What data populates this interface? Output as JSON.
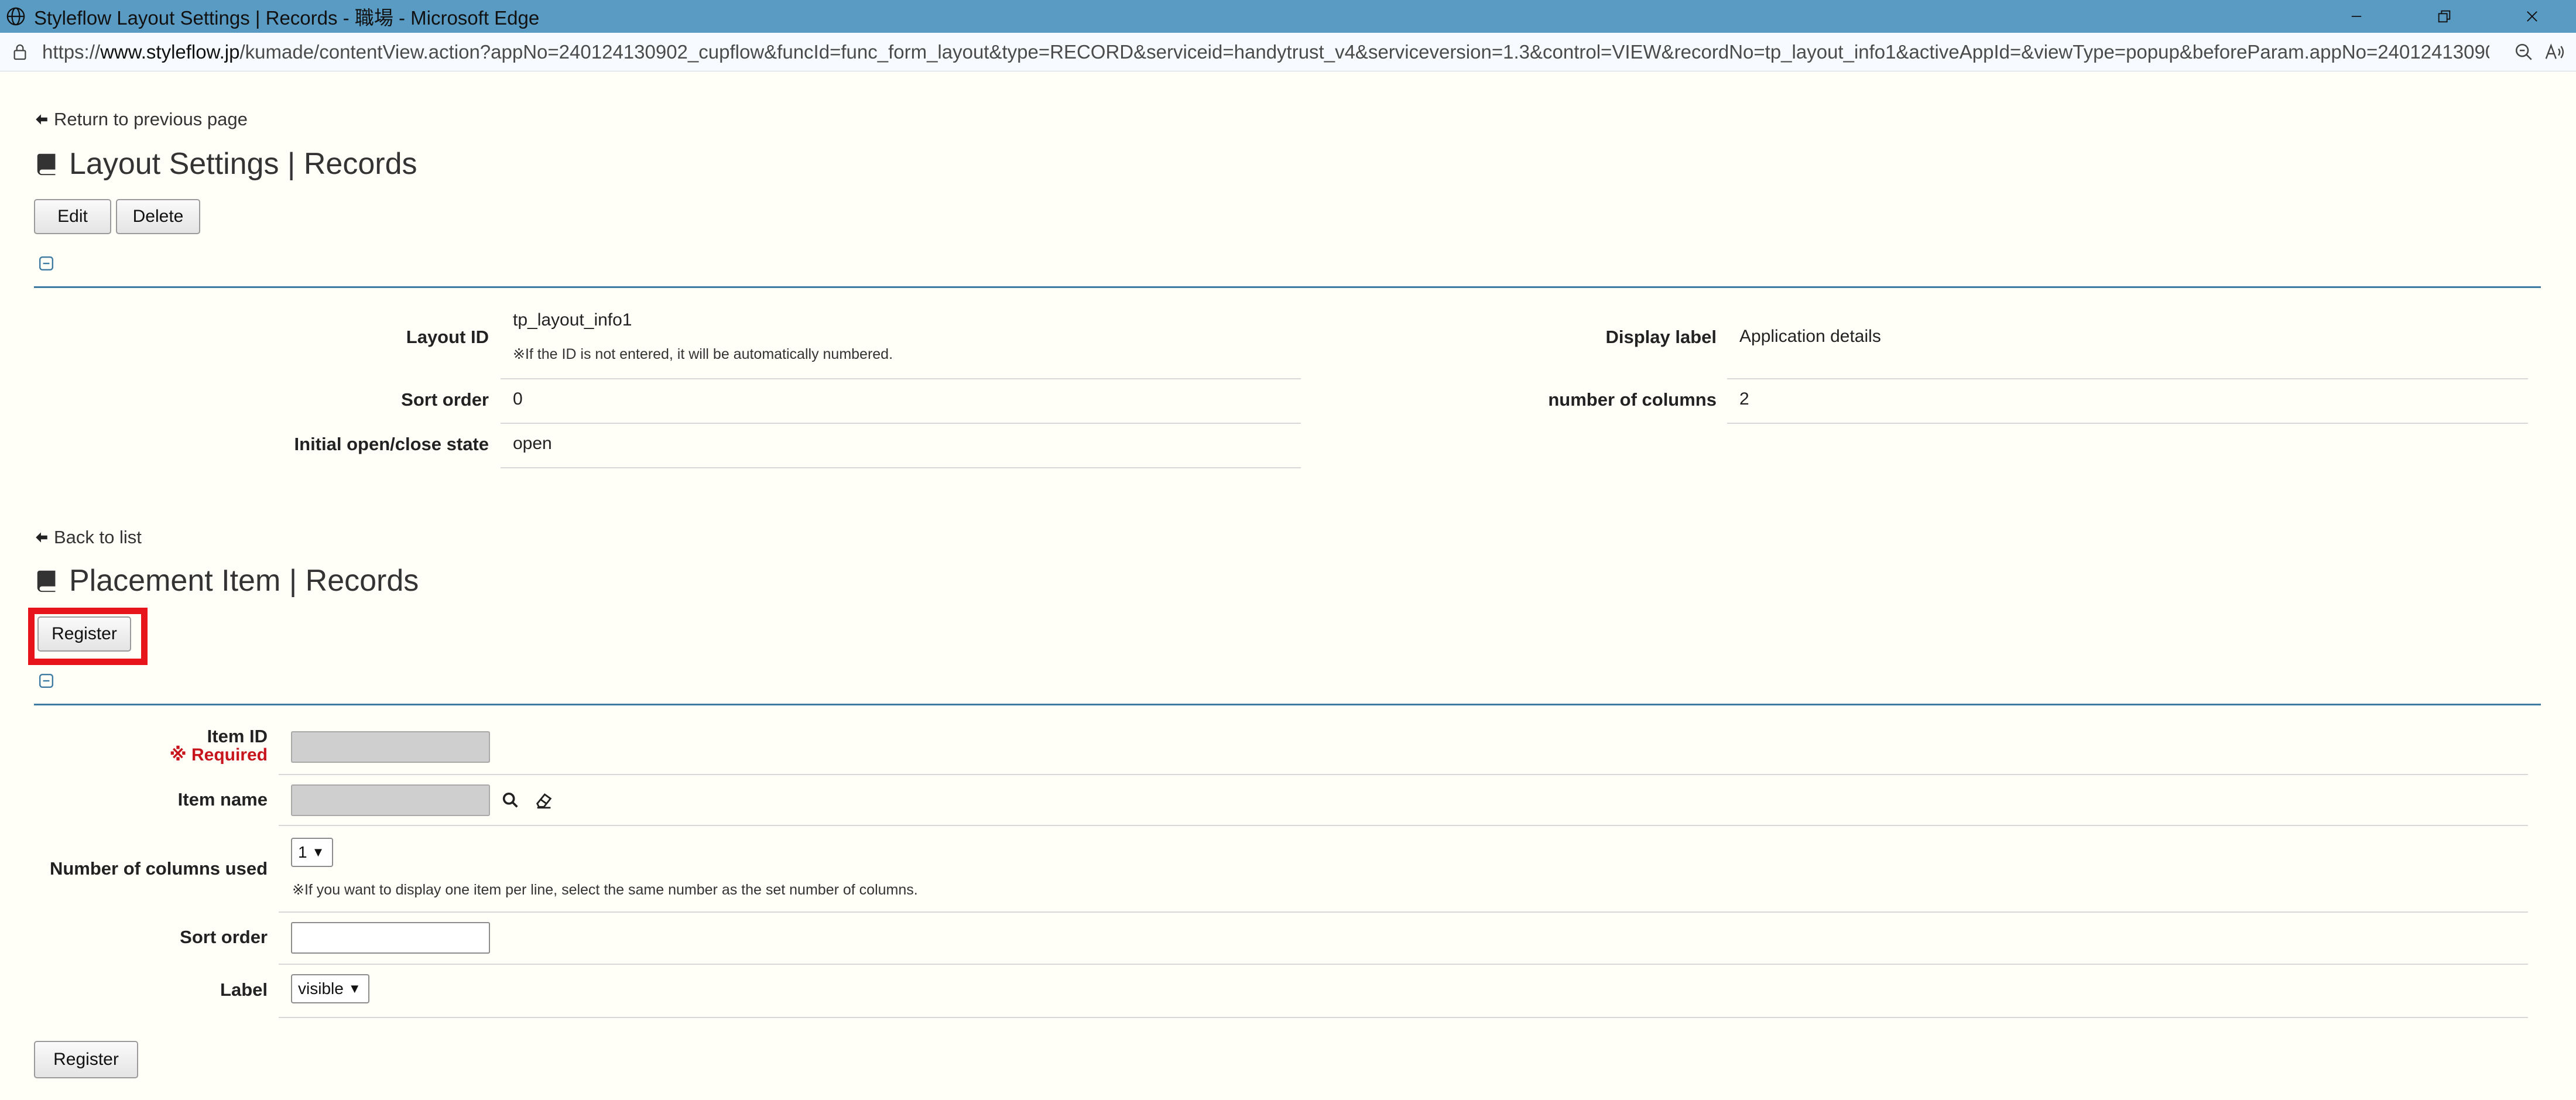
{
  "window": {
    "title": "Styleflow Layout Settings | Records - 職場 - Microsoft Edge",
    "url_prefix": "https://",
    "url_host": "www.styleflow.jp",
    "url_rest": "/kumade/contentView.action?appNo=240124130902_cupflow&funcId=func_form_layout&type=RECORD&serviceid=handytrust_v4&serviceversion=1.3&control=VIEW&recordNo=tp_layout_info1&activeAppId=&viewType=popup&beforeParam.appNo=240124130902_c..."
  },
  "layout_section": {
    "back_link": "Return to previous page",
    "heading": "Layout Settings | Records",
    "edit_label": "Edit",
    "delete_label": "Delete",
    "fields": {
      "layout_id_label": "Layout ID",
      "layout_id_value": "tp_layout_info1",
      "layout_id_note": "※If the ID is not entered, it will be automatically numbered.",
      "display_label_label": "Display label",
      "display_label_value": "Application details",
      "sort_order_label": "Sort order",
      "sort_order_value": "0",
      "columns_label": "number of columns",
      "columns_value": "2",
      "initial_state_label": "Initial open/close state",
      "initial_state_value": "open"
    }
  },
  "placement_section": {
    "back_link": "Back to list",
    "heading": "Placement Item | Records",
    "register_label": "Register",
    "form": {
      "item_id_label": "Item ID",
      "required_text": "※ Required",
      "item_name_label": "Item name",
      "columns_used_label": "Number of columns used",
      "columns_used_value": "1",
      "columns_used_note": "※If you want to display one item per line, select the same number as the set number of columns.",
      "sort_order_label": "Sort order",
      "sort_order_value": "",
      "label_label": "Label",
      "label_value": "visible"
    },
    "register_bottom_label": "Register"
  }
}
